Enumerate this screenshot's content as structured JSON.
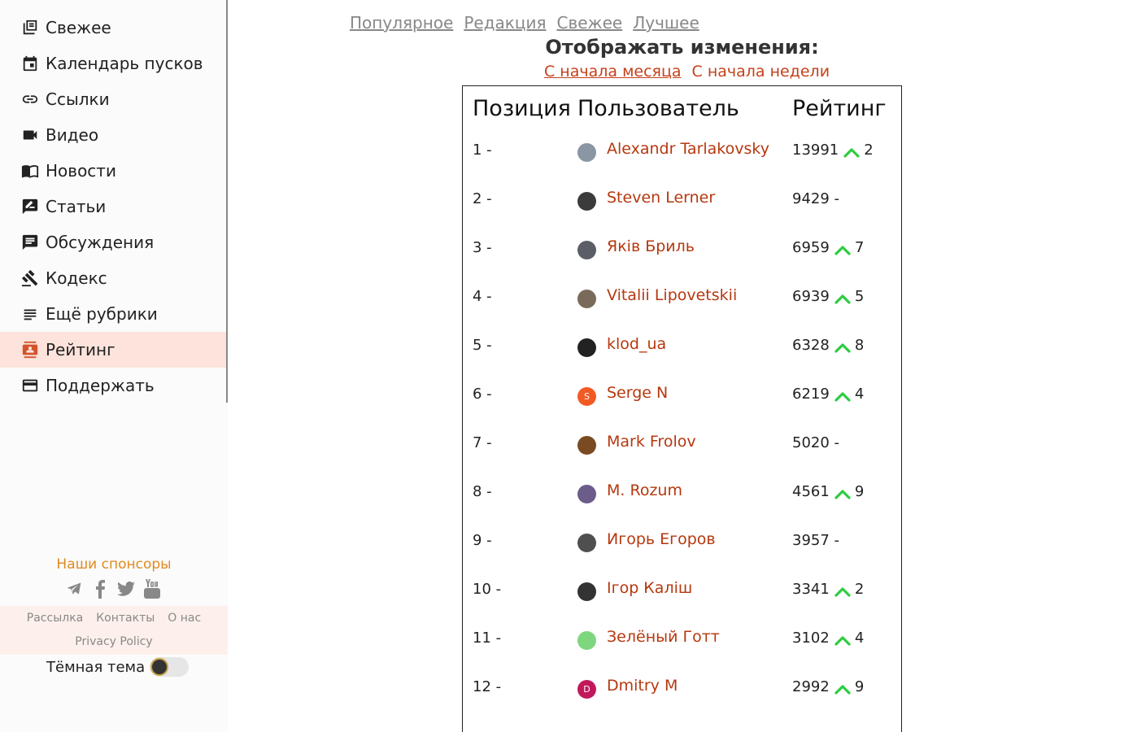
{
  "sidebar": {
    "items": [
      {
        "label": "Свежее",
        "icon": "fresh-icon"
      },
      {
        "label": "Календарь пусков",
        "icon": "calendar-icon"
      },
      {
        "label": "Ссылки",
        "icon": "link-icon"
      },
      {
        "label": "Видео",
        "icon": "video-icon"
      },
      {
        "label": "Новости",
        "icon": "news-icon"
      },
      {
        "label": "Статьи",
        "icon": "article-icon"
      },
      {
        "label": "Обсуждения",
        "icon": "chat-icon"
      },
      {
        "label": "Кодекс",
        "icon": "gavel-icon"
      },
      {
        "label": "Ещё рубрики",
        "icon": "list-icon"
      },
      {
        "label": "Рейтинг",
        "icon": "rating-icon",
        "active": true
      },
      {
        "label": "Поддержать",
        "icon": "card-icon"
      }
    ],
    "sponsors": "Наши спонсоры",
    "footer_links": [
      "Рассылка",
      "Контакты",
      "О нас"
    ],
    "privacy": "Privacy Policy",
    "theme_label": "Тёмная тема"
  },
  "top_tabs": [
    "Популярное",
    "Редакция",
    "Свежее",
    "Лучшее"
  ],
  "heading": "Отображать изменения:",
  "period": {
    "active": "С начала месяца",
    "other": "С начала недели"
  },
  "table": {
    "headers": {
      "position": "Позиция",
      "user": "Пользователь",
      "rating": "Рейтинг"
    },
    "rows": [
      {
        "pos": "1 -",
        "name": "Alexandr Tarlakovsky",
        "rating": "13991",
        "change": "2",
        "up": true,
        "avatar_color": "#8a96a4"
      },
      {
        "pos": "2 -",
        "name": "Steven Lerner",
        "rating": "9429 -",
        "change": "",
        "up": false,
        "avatar_color": "#3b3b3b"
      },
      {
        "pos": "3 -",
        "name": "Яків Бриль",
        "rating": "6959",
        "change": "7",
        "up": true,
        "avatar_color": "#5b5e66"
      },
      {
        "pos": "4 -",
        "name": "Vitalii Lipovetskii",
        "rating": "6939",
        "change": "5",
        "up": true,
        "avatar_color": "#7a6a5a"
      },
      {
        "pos": "5 -",
        "name": "klod_ua",
        "rating": "6328",
        "change": "8",
        "up": true,
        "avatar_color": "#222222"
      },
      {
        "pos": "6 -",
        "name": "Serge N",
        "rating": "6219",
        "change": "4",
        "up": true,
        "avatar_color": "#f25a24",
        "initial": "S"
      },
      {
        "pos": "7 -",
        "name": "Mark Frolov",
        "rating": "5020 -",
        "change": "",
        "up": false,
        "avatar_color": "#7a4a22"
      },
      {
        "pos": "8 -",
        "name": "M. Rozum",
        "rating": "4561",
        "change": "9",
        "up": true,
        "avatar_color": "#6b5c8a"
      },
      {
        "pos": "9 -",
        "name": "Игорь Егоров",
        "rating": "3957 -",
        "change": "",
        "up": false,
        "avatar_color": "#4f4f4f"
      },
      {
        "pos": "10 -",
        "name": "Ігор Каліш",
        "rating": "3341",
        "change": "2",
        "up": true,
        "avatar_color": "#333333"
      },
      {
        "pos": "11 -",
        "name": "Зелёный Готт",
        "rating": "3102",
        "change": "4",
        "up": true,
        "avatar_color": "#7ed67e"
      },
      {
        "pos": "12 -",
        "name": "Dmitry M",
        "rating": "2992",
        "change": "9",
        "up": true,
        "avatar_color": "#c2185b",
        "initial": "D"
      }
    ]
  },
  "colors": {
    "accent": "#c5401a",
    "active_bg": "#fde3dc",
    "up_arrow": "#2ecc40"
  }
}
